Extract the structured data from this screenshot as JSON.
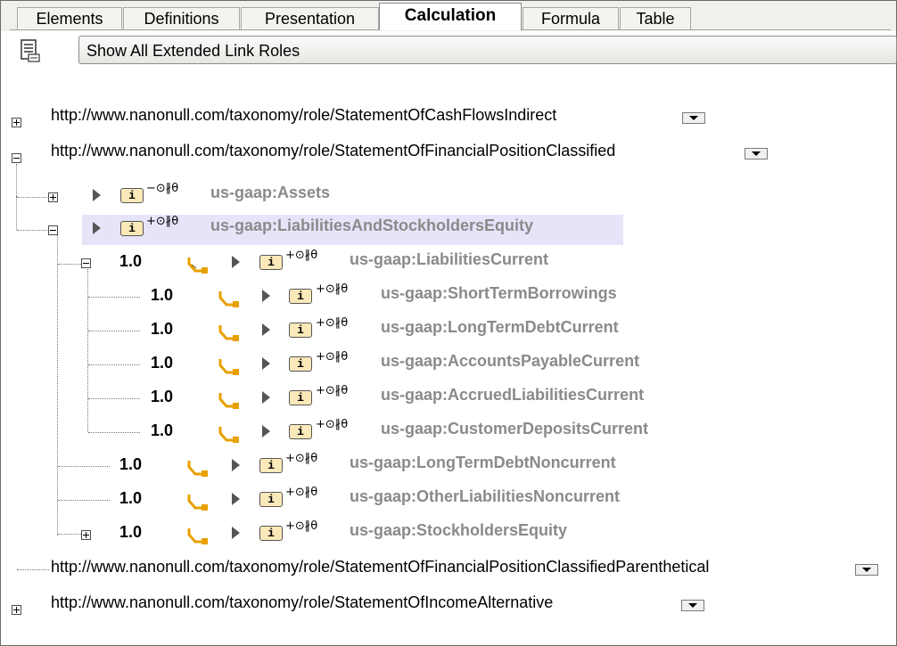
{
  "tabs": [
    {
      "label": "Elements",
      "active": false
    },
    {
      "label": "Definitions",
      "active": false
    },
    {
      "label": "Presentation",
      "active": false
    },
    {
      "label": "Calculation",
      "active": true
    },
    {
      "label": "Formula",
      "active": false
    },
    {
      "label": "Table",
      "active": false
    }
  ],
  "toolbar": {
    "role_filter_label": "Show All Extended Link Roles"
  },
  "roles": [
    {
      "url": "http://www.nanonull.com/taxonomy/role/StatementOfCashFlowsIndirect",
      "state": "collapsed"
    },
    {
      "url": "http://www.nanonull.com/taxonomy/role/StatementOfFinancialPositionClassified",
      "state": "expanded"
    },
    {
      "url": "http://www.nanonull.com/taxonomy/role/StatementOfFinancialPositionClassifiedParenthetical",
      "state": "leaf"
    },
    {
      "url": "http://www.nanonull.com/taxonomy/role/StatementOfIncomeAlternative",
      "state": "collapsed"
    }
  ],
  "tree": [
    {
      "weight": "",
      "flags": "−⊙∦θ",
      "name": "us-gaap:Assets"
    },
    {
      "weight": "",
      "flags": "+⊙∦θ",
      "name": "us-gaap:LiabilitiesAndStockholdersEquity"
    },
    {
      "weight": "1.0",
      "flags": "+⊙∦θ",
      "name": "us-gaap:LiabilitiesCurrent"
    },
    {
      "weight": "1.0",
      "flags": "+⊙∦θ",
      "name": "us-gaap:ShortTermBorrowings"
    },
    {
      "weight": "1.0",
      "flags": "+⊙∦θ",
      "name": "us-gaap:LongTermDebtCurrent"
    },
    {
      "weight": "1.0",
      "flags": "+⊙∦θ",
      "name": "us-gaap:AccountsPayableCurrent"
    },
    {
      "weight": "1.0",
      "flags": "+⊙∦θ",
      "name": "us-gaap:AccruedLiabilitiesCurrent"
    },
    {
      "weight": "1.0",
      "flags": "+⊙∦θ",
      "name": "us-gaap:CustomerDepositsCurrent"
    },
    {
      "weight": "1.0",
      "flags": "+⊙∦θ",
      "name": "us-gaap:LongTermDebtNoncurrent"
    },
    {
      "weight": "1.0",
      "flags": "+⊙∦θ",
      "name": "us-gaap:OtherLiabilitiesNoncurrent"
    },
    {
      "weight": "1.0",
      "flags": "+⊙∦θ",
      "name": "us-gaap:StockholdersEquity"
    }
  ],
  "colors": {
    "element_text": "#8a8a8a",
    "selection": "#e7e4fa",
    "info_badge": "#fbe9b9",
    "link_icon": "#e8a000"
  },
  "icons": {
    "info": "i",
    "toolbar": "list-view-icon",
    "link": "calculation-link-icon",
    "expand": "plus-box-icon",
    "collapse": "minus-box-icon",
    "child_arrow": "triangle-right-icon",
    "dropdown": "dropdown-arrow-icon"
  }
}
